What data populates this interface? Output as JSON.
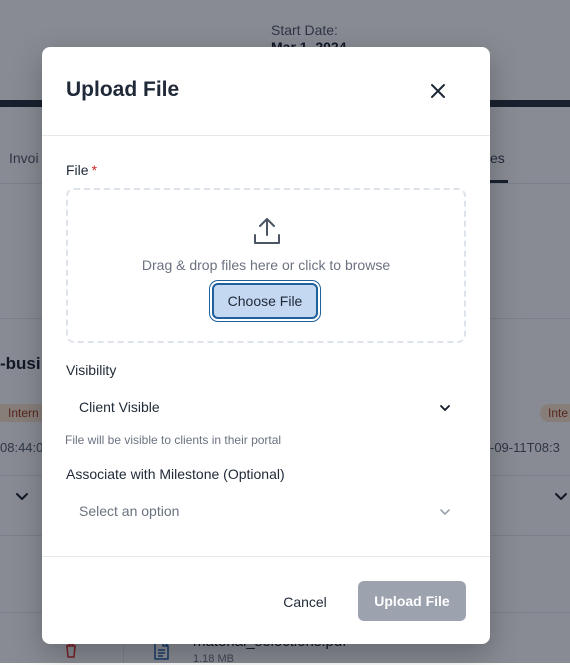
{
  "background": {
    "start_date_label": "Start Date:",
    "start_date_value": "Mar 1, 2024",
    "tab_left_label": "Invoi",
    "tab_right_label": "es",
    "section_title": "-busi",
    "badge_left": "Intern",
    "badge_right": "Inte",
    "timestamp_left": "08:44:0",
    "timestamp_right": "-09-11T08:3",
    "file_name": "material_selections.pdf",
    "file_size": "1.18 MB"
  },
  "modal": {
    "title": "Upload File",
    "close_icon": "close-icon",
    "file_field": {
      "label": "File",
      "required_marker": "*",
      "drop_text": "Drag & drop files here or click to browse",
      "choose_button_label": "Choose File",
      "icon": "upload-icon"
    },
    "visibility_field": {
      "label": "Visibility",
      "selected_value": "Client Visible",
      "helper_text": "File will be visible to clients in their portal"
    },
    "milestone_field": {
      "label": "Associate with Milestone (Optional)",
      "placeholder": "Select an option"
    },
    "footer": {
      "cancel_label": "Cancel",
      "upload_label": "Upload File"
    }
  },
  "colors": {
    "overlay": "#111827",
    "required": "#dc2626",
    "choose_button_bg": "#c4d8f2",
    "focus_ring": "#1e5f9c",
    "upload_button_disabled": "#9ca3af"
  }
}
